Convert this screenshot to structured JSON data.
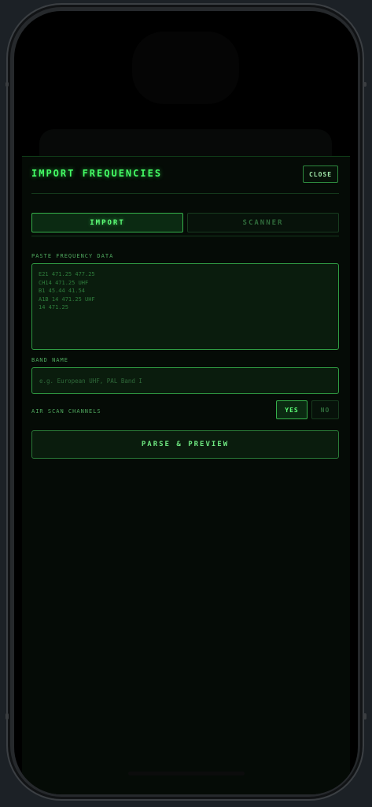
{
  "modal": {
    "title": "IMPORT FREQUENCIES",
    "close_label": "CLOSE"
  },
  "tabs": [
    {
      "label": "IMPORT",
      "active": true
    },
    {
      "label": "SCANNER",
      "active": false
    }
  ],
  "paste": {
    "label": "PASTE FREQUENCY DATA",
    "placeholder": "E21 471.25 477.25\nCH14 471.25 UHF\nB1 45.44 41.54\nA1B 14 471.25 UHF\n14 471.25"
  },
  "band": {
    "label": "BAND NAME",
    "placeholder": "e.g. European UHF, PAL Band I"
  },
  "scan": {
    "label": "AIR SCAN CHANNELS",
    "yes_label": "YES",
    "no_label": "NO",
    "selected": "YES"
  },
  "parse_label": "PARSE & PREVIEW",
  "colors": {
    "accent": "#44ff66",
    "background": "#050b06",
    "border": "#2f9a42"
  }
}
